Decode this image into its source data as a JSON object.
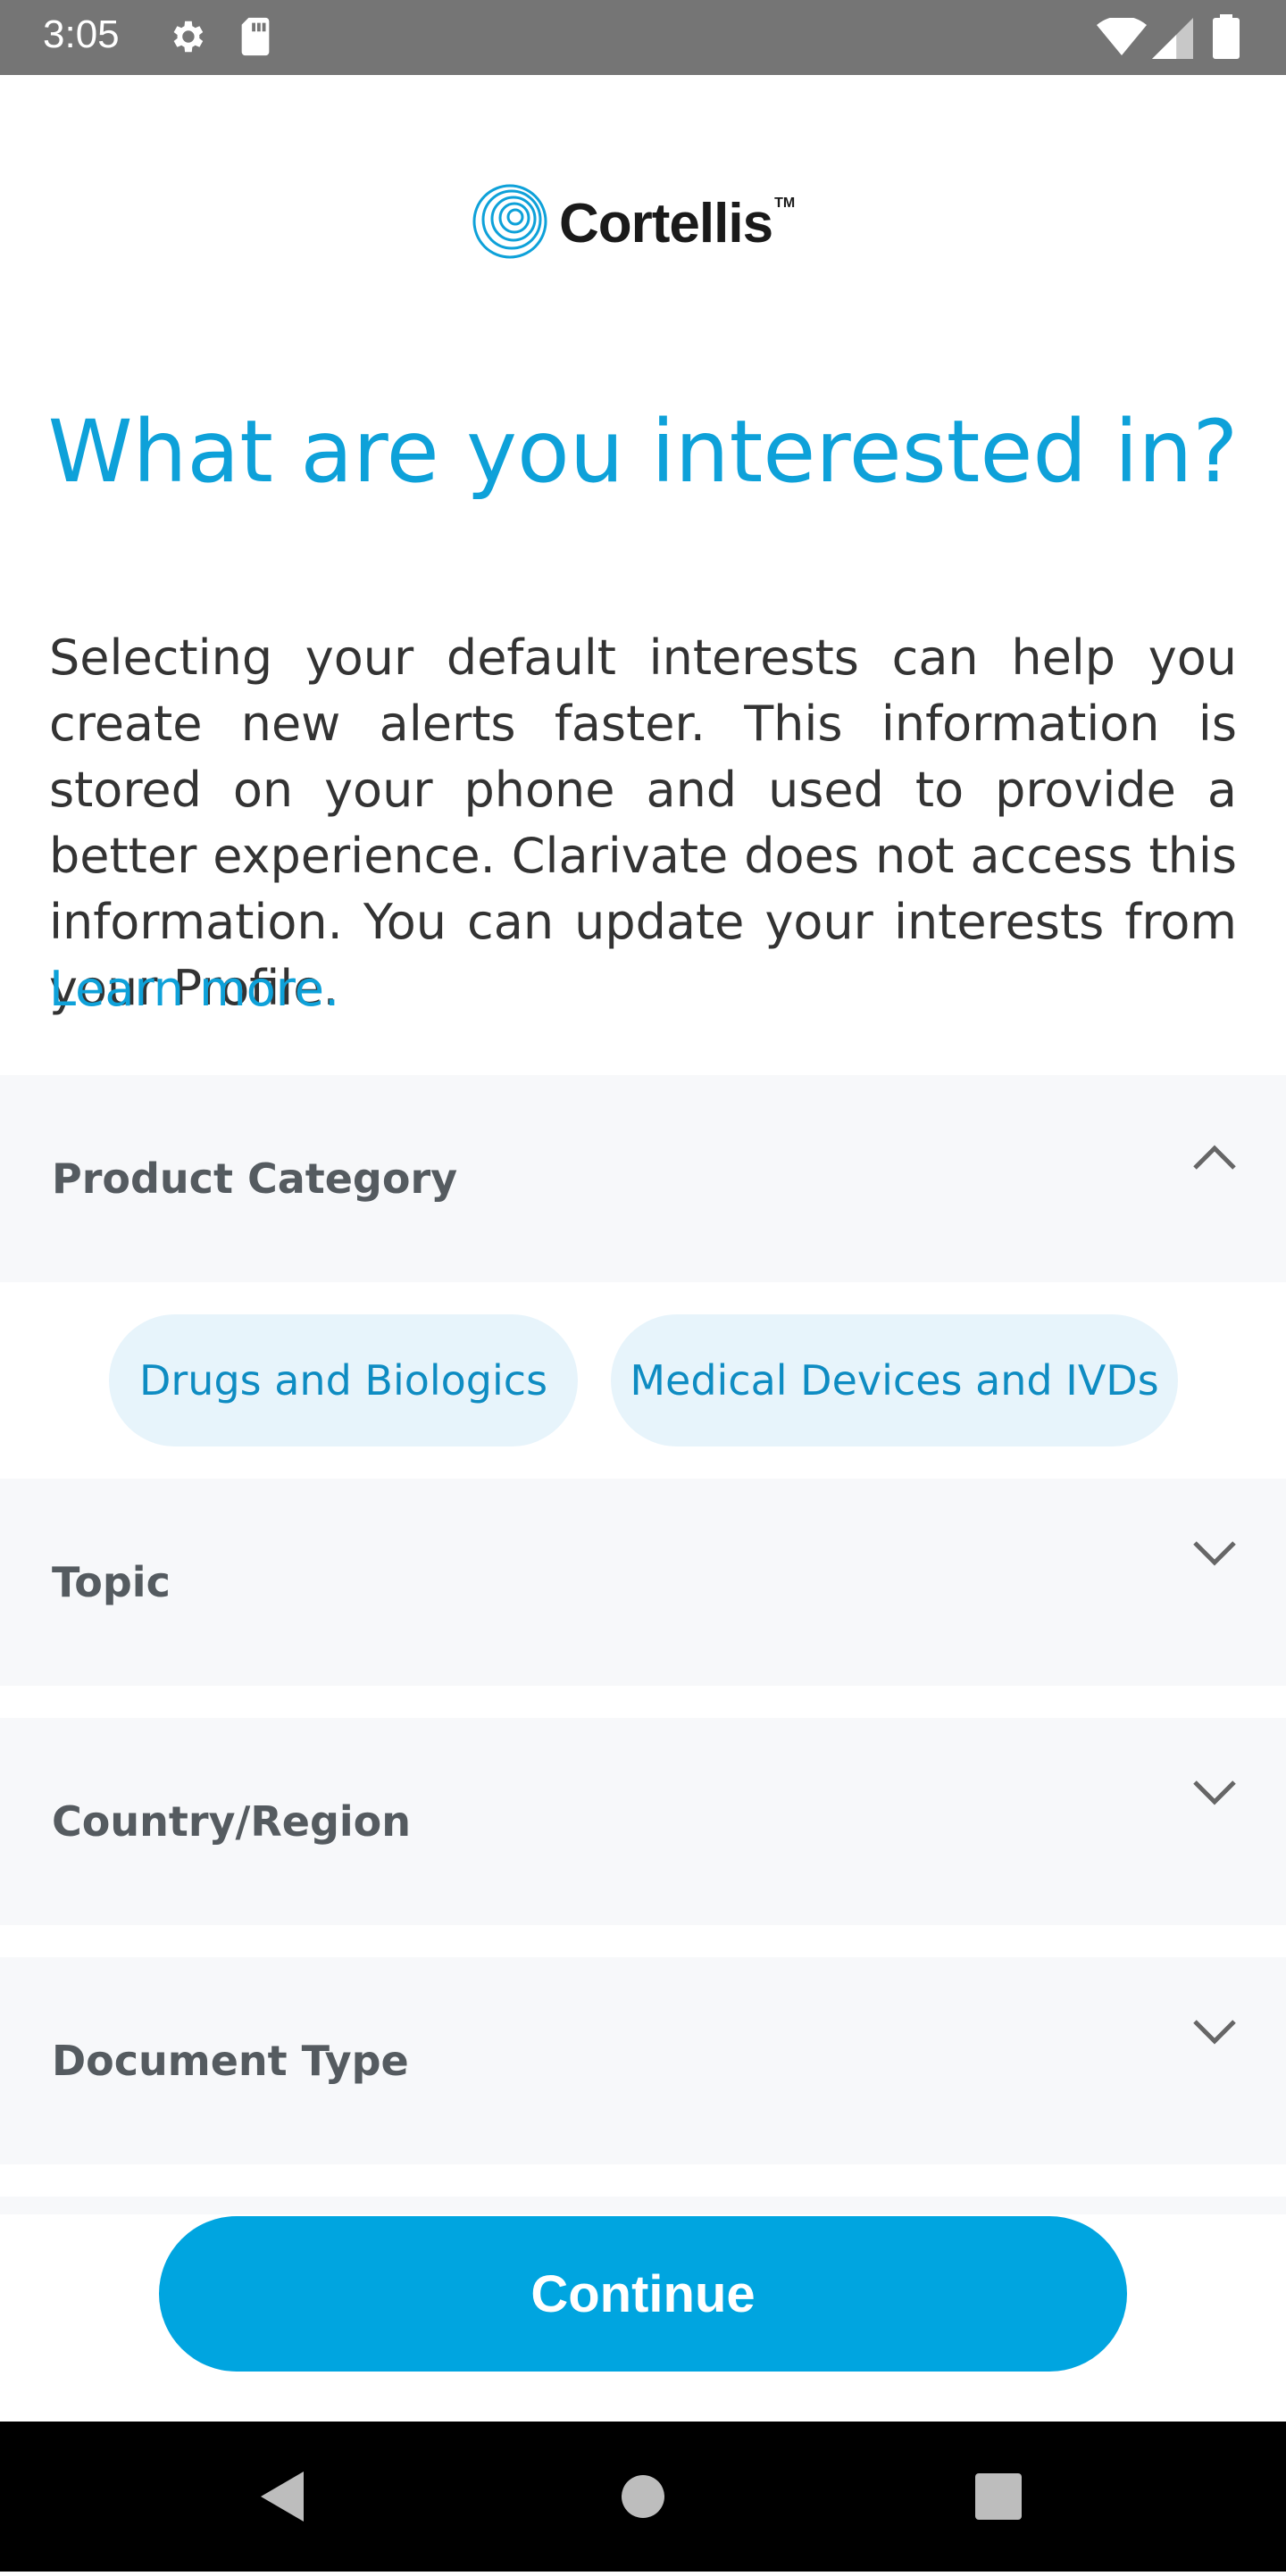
{
  "status_bar": {
    "time": "3:05",
    "icons": [
      "settings-icon",
      "sd-card-icon",
      "wifi-icon",
      "signal-icon",
      "battery-icon"
    ]
  },
  "logo": {
    "brand": "Cortellis",
    "trademark": "TM"
  },
  "page_title": "What are you interested in?",
  "description": "Selecting your default interests can help you create new alerts faster. This information is stored on your phone and used to provide a better experience. Clarivate does not access this information. You can update your interests from your Profile.",
  "learn_more": "Learn more.",
  "sections": [
    {
      "label": "Product Category",
      "expanded": true,
      "options": [
        "Drugs and Biologics",
        "Medical Devices and IVDs"
      ]
    },
    {
      "label": "Topic",
      "expanded": false
    },
    {
      "label": "Country/Region",
      "expanded": false
    },
    {
      "label": "Document Type",
      "expanded": false
    }
  ],
  "continue_label": "Continue",
  "colors": {
    "accent": "#00a5e0",
    "title": "#0ea1d9",
    "chip_bg": "#e7f4fb",
    "section_bg": "#f7f8fa"
  }
}
